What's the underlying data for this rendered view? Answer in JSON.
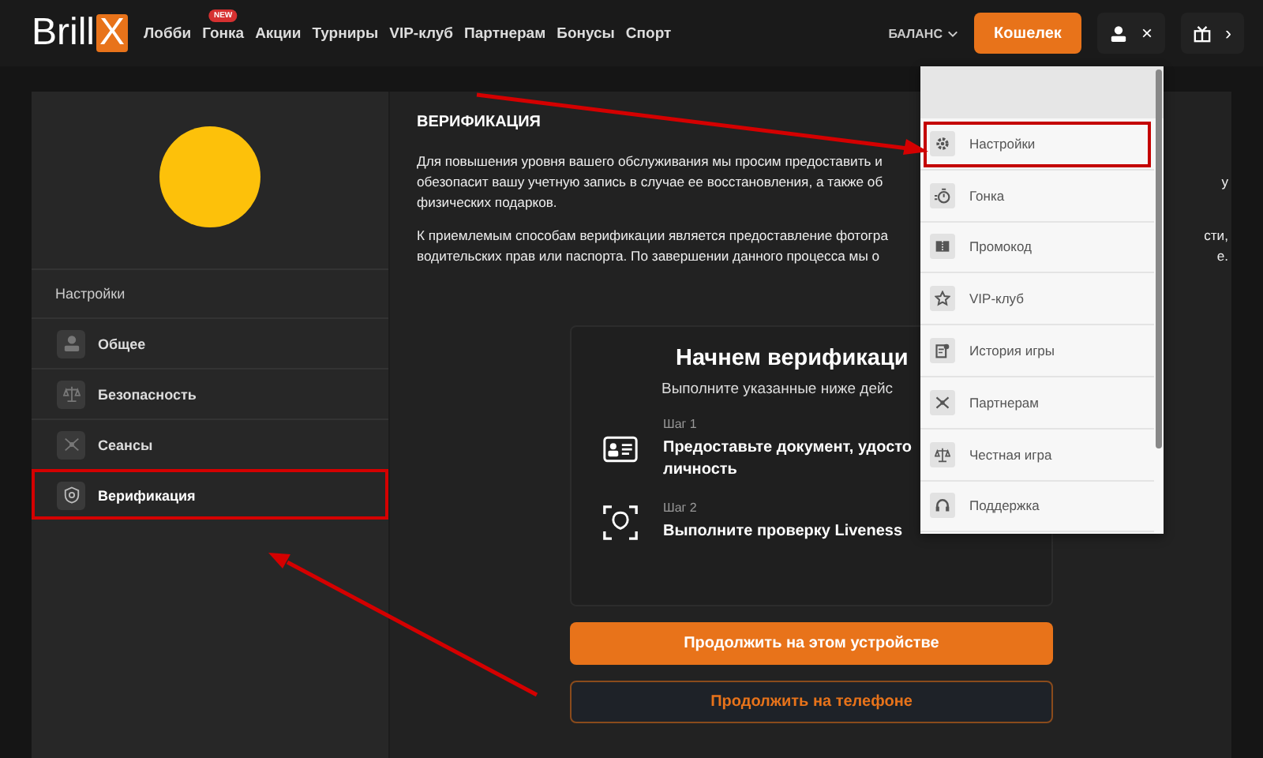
{
  "header": {
    "logo": {
      "text": "Brill",
      "mark": "X"
    },
    "nav": [
      {
        "label": "Лобби"
      },
      {
        "label": "Гонка",
        "badge": "NEW"
      },
      {
        "label": "Акции"
      },
      {
        "label": "Турниры"
      },
      {
        "label": "VIP-клуб"
      },
      {
        "label": "Партнерам"
      },
      {
        "label": "Бонусы"
      },
      {
        "label": "Спорт"
      }
    ],
    "balance": "БАЛАНС",
    "wallet_button": "Кошелек",
    "close_glyph": "×",
    "next_glyph": "›"
  },
  "sidebar": {
    "heading": "Настройки",
    "items": [
      {
        "label": "Общее",
        "selected": false,
        "highlighted": false
      },
      {
        "label": "Безопасность",
        "selected": false,
        "highlighted": false
      },
      {
        "label": "Сеансы",
        "selected": false,
        "highlighted": false
      },
      {
        "label": "Верификация",
        "selected": true,
        "highlighted": true
      }
    ]
  },
  "content": {
    "title": "ВЕРИФИКАЦИЯ",
    "paragraphs": [
      [
        {
          "left": "Для повышения уровня вашего обслуживания мы просим предоставить и"
        },
        {
          "left": "обезопасит вашу учетную запись в случае ее восстановления, а также об",
          "right": "у"
        },
        {
          "left": "физических подарков."
        }
      ],
      [
        {
          "left": "К приемлемым способам верификации является предоставление фотогра",
          "right": "сти,"
        },
        {
          "left": "водительских прав или паспорта. По завершении данного процесса мы о",
          "right": "е."
        }
      ]
    ],
    "card": {
      "title": "Начнем верификаци",
      "subtitle": "Выполните указанные ниже дейс",
      "steps": [
        {
          "step": "Шаг 1",
          "lines": [
            "Предоставьте документ, удосто",
            "личность"
          ]
        },
        {
          "step": "Шаг 2",
          "lines": [
            "Выполните проверку Liveness"
          ]
        }
      ]
    },
    "primary_button": "Продолжить на этом устройстве",
    "secondary_button": "Продолжить на телефоне"
  },
  "menu": {
    "items": [
      {
        "label": "Настройки",
        "highlighted": true
      },
      {
        "label": "Гонка",
        "highlighted": false
      },
      {
        "label": "Промокод",
        "highlighted": false
      },
      {
        "label": "VIP-клуб",
        "highlighted": false
      },
      {
        "label": "История игры",
        "highlighted": false
      },
      {
        "label": "Партнерам",
        "highlighted": false
      },
      {
        "label": "Честная игра",
        "highlighted": false
      },
      {
        "label": "Поддержка",
        "highlighted": false
      }
    ]
  }
}
